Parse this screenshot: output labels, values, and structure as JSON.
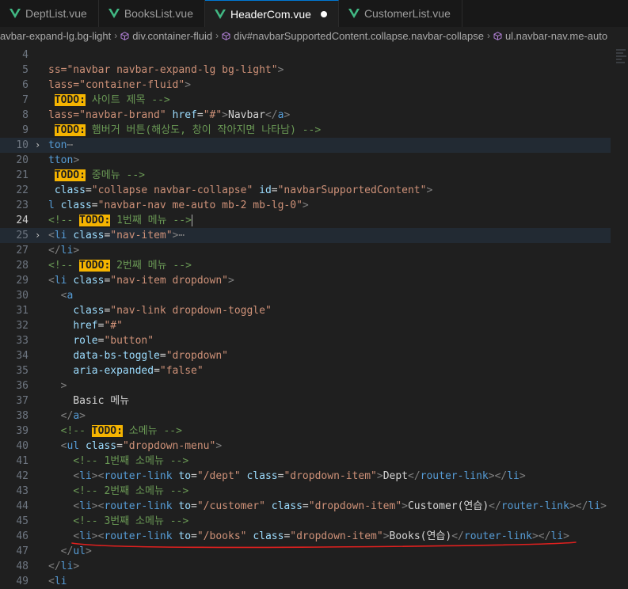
{
  "tabs": [
    {
      "label": "DeptList.vue",
      "active": false
    },
    {
      "label": "BooksList.vue",
      "active": false
    },
    {
      "label": "HeaderCom.vue",
      "active": true,
      "modified": true
    },
    {
      "label": "CustomerList.vue",
      "active": false
    }
  ],
  "breadcrumbs": [
    "avbar-expand-lg.bg-light",
    "div.container-fluid",
    "div#navbarSupportedContent.collapse.navbar-collapse",
    "ul.navbar-nav.me-auto"
  ],
  "colors": {
    "accent": "#0078d4",
    "todo": "#f5b400",
    "annotation": "#e0201f"
  },
  "lines": [
    {
      "num": "4",
      "tokens": []
    },
    {
      "num": "5",
      "tokens": [
        [
          "s",
          "ss=\"navbar navbar-expand-lg bg-light\""
        ],
        [
          "p",
          ">"
        ]
      ]
    },
    {
      "num": "6",
      "tokens": [
        [
          "s",
          "lass=\"container-fluid\""
        ],
        [
          "p",
          ">"
        ]
      ]
    },
    {
      "num": "7",
      "tokens": [
        [
          "w",
          " "
        ],
        [
          "todo",
          "TODO:"
        ],
        [
          "c",
          " 사이트 제목 -->"
        ]
      ]
    },
    {
      "num": "8",
      "tokens": [
        [
          "s",
          "lass=\"navbar-brand\""
        ],
        [
          "w",
          " "
        ],
        [
          "a",
          "href"
        ],
        [
          "w",
          "="
        ],
        [
          "s",
          "\"#\""
        ],
        [
          "p",
          ">"
        ],
        [
          "w",
          "Navbar"
        ],
        [
          "p",
          "</"
        ],
        [
          "t",
          "a"
        ],
        [
          "p",
          ">"
        ]
      ]
    },
    {
      "num": "9",
      "tokens": [
        [
          "w",
          " "
        ],
        [
          "todo",
          "TODO:"
        ],
        [
          "c",
          " 햄버거 버튼(해상도, 창이 작아지면 나타남) -->"
        ]
      ]
    },
    {
      "num": "10",
      "fold": true,
      "highlight": true,
      "tokens": [
        [
          "t",
          "ton"
        ],
        [
          "p",
          "⋯"
        ]
      ]
    },
    {
      "num": "20",
      "tokens": [
        [
          "t",
          "tton"
        ],
        [
          "p",
          ">"
        ]
      ]
    },
    {
      "num": "21",
      "tokens": [
        [
          "w",
          " "
        ],
        [
          "todo",
          "TODO:"
        ],
        [
          "c",
          " 중메뉴 -->"
        ]
      ]
    },
    {
      "num": "22",
      "tokens": [
        [
          "w",
          " "
        ],
        [
          "a",
          "class"
        ],
        [
          "w",
          "="
        ],
        [
          "s",
          "\"collapse navbar-collapse\""
        ],
        [
          "w",
          " "
        ],
        [
          "a",
          "id"
        ],
        [
          "w",
          "="
        ],
        [
          "s",
          "\"navbarSupportedContent\""
        ],
        [
          "p",
          ">"
        ]
      ]
    },
    {
      "num": "23",
      "tokens": [
        [
          "t",
          "l"
        ],
        [
          "w",
          " "
        ],
        [
          "a",
          "class"
        ],
        [
          "w",
          "="
        ],
        [
          "s",
          "\"navbar-nav me-auto mb-2 mb-lg-0\""
        ],
        [
          "p",
          ">"
        ]
      ]
    },
    {
      "num": "24",
      "current": true,
      "tokens": [
        [
          "c",
          "<!-- "
        ],
        [
          "todo",
          "TODO:"
        ],
        [
          "c",
          " 1번째 메뉴 -->"
        ],
        [
          "cursor",
          ""
        ]
      ]
    },
    {
      "num": "25",
      "fold": true,
      "highlight": true,
      "tokens": [
        [
          "p",
          "<"
        ],
        [
          "t",
          "li"
        ],
        [
          "w",
          " "
        ],
        [
          "a",
          "class"
        ],
        [
          "w",
          "="
        ],
        [
          "s",
          "\"nav-item\""
        ],
        [
          "p",
          ">⋯"
        ]
      ]
    },
    {
      "num": "27",
      "tokens": [
        [
          "p",
          "</"
        ],
        [
          "t",
          "li"
        ],
        [
          "p",
          ">"
        ]
      ]
    },
    {
      "num": "28",
      "tokens": [
        [
          "c",
          "<!-- "
        ],
        [
          "todo",
          "TODO:"
        ],
        [
          "c",
          " 2번째 메뉴 -->"
        ]
      ]
    },
    {
      "num": "29",
      "tokens": [
        [
          "p",
          "<"
        ],
        [
          "t",
          "li"
        ],
        [
          "w",
          " "
        ],
        [
          "a",
          "class"
        ],
        [
          "w",
          "="
        ],
        [
          "s",
          "\"nav-item dropdown\""
        ],
        [
          "p",
          ">"
        ]
      ]
    },
    {
      "num": "30",
      "tokens": [
        [
          "w",
          "  "
        ],
        [
          "p",
          "<"
        ],
        [
          "t",
          "a"
        ]
      ]
    },
    {
      "num": "31",
      "tokens": [
        [
          "w",
          "    "
        ],
        [
          "a",
          "class"
        ],
        [
          "w",
          "="
        ],
        [
          "s",
          "\"nav-link dropdown-toggle\""
        ]
      ]
    },
    {
      "num": "32",
      "tokens": [
        [
          "w",
          "    "
        ],
        [
          "a",
          "href"
        ],
        [
          "w",
          "="
        ],
        [
          "s",
          "\"#\""
        ]
      ]
    },
    {
      "num": "33",
      "tokens": [
        [
          "w",
          "    "
        ],
        [
          "a",
          "role"
        ],
        [
          "w",
          "="
        ],
        [
          "s",
          "\"button\""
        ]
      ]
    },
    {
      "num": "34",
      "tokens": [
        [
          "w",
          "    "
        ],
        [
          "a",
          "data-bs-toggle"
        ],
        [
          "w",
          "="
        ],
        [
          "s",
          "\"dropdown\""
        ]
      ]
    },
    {
      "num": "35",
      "tokens": [
        [
          "w",
          "    "
        ],
        [
          "a",
          "aria-expanded"
        ],
        [
          "w",
          "="
        ],
        [
          "s",
          "\"false\""
        ]
      ]
    },
    {
      "num": "36",
      "tokens": [
        [
          "w",
          "  "
        ],
        [
          "p",
          ">"
        ]
      ]
    },
    {
      "num": "37",
      "tokens": [
        [
          "w",
          "    Basic 메뉴"
        ]
      ]
    },
    {
      "num": "38",
      "tokens": [
        [
          "w",
          "  "
        ],
        [
          "p",
          "</"
        ],
        [
          "t",
          "a"
        ],
        [
          "p",
          ">"
        ]
      ]
    },
    {
      "num": "39",
      "tokens": [
        [
          "w",
          "  "
        ],
        [
          "c",
          "<!-- "
        ],
        [
          "todo",
          "TODO:"
        ],
        [
          "c",
          " 소메뉴 -->"
        ]
      ]
    },
    {
      "num": "40",
      "tokens": [
        [
          "w",
          "  "
        ],
        [
          "p",
          "<"
        ],
        [
          "t",
          "ul"
        ],
        [
          "w",
          " "
        ],
        [
          "a",
          "class"
        ],
        [
          "w",
          "="
        ],
        [
          "s",
          "\"dropdown-menu\""
        ],
        [
          "p",
          ">"
        ]
      ]
    },
    {
      "num": "41",
      "tokens": [
        [
          "w",
          "    "
        ],
        [
          "c",
          "<!-- 1번째 소메뉴 -->"
        ]
      ]
    },
    {
      "num": "42",
      "tokens": [
        [
          "w",
          "    "
        ],
        [
          "p",
          "<"
        ],
        [
          "t",
          "li"
        ],
        [
          "p",
          "><"
        ],
        [
          "t",
          "router-link"
        ],
        [
          "w",
          " "
        ],
        [
          "a",
          "to"
        ],
        [
          "w",
          "="
        ],
        [
          "s",
          "\"/dept\""
        ],
        [
          "w",
          " "
        ],
        [
          "a",
          "class"
        ],
        [
          "w",
          "="
        ],
        [
          "s",
          "\"dropdown-item\""
        ],
        [
          "p",
          ">"
        ],
        [
          "w",
          "Dept"
        ],
        [
          "p",
          "</"
        ],
        [
          "t",
          "router-link"
        ],
        [
          "p",
          "></"
        ],
        [
          "t",
          "li"
        ],
        [
          "p",
          ">"
        ]
      ]
    },
    {
      "num": "43",
      "tokens": [
        [
          "w",
          "    "
        ],
        [
          "c",
          "<!-- 2번째 소메뉴 -->"
        ]
      ]
    },
    {
      "num": "44",
      "tokens": [
        [
          "w",
          "    "
        ],
        [
          "p",
          "<"
        ],
        [
          "t",
          "li"
        ],
        [
          "p",
          "><"
        ],
        [
          "t",
          "router-link"
        ],
        [
          "w",
          " "
        ],
        [
          "a",
          "to"
        ],
        [
          "w",
          "="
        ],
        [
          "s",
          "\"/customer\""
        ],
        [
          "w",
          " "
        ],
        [
          "a",
          "class"
        ],
        [
          "w",
          "="
        ],
        [
          "s",
          "\"dropdown-item\""
        ],
        [
          "p",
          ">"
        ],
        [
          "w",
          "Customer(연습)"
        ],
        [
          "p",
          "</"
        ],
        [
          "t",
          "router-link"
        ],
        [
          "p",
          "></"
        ],
        [
          "t",
          "li"
        ],
        [
          "p",
          ">"
        ]
      ]
    },
    {
      "num": "45",
      "tokens": [
        [
          "w",
          "    "
        ],
        [
          "c",
          "<!-- 3번째 소메뉴 -->"
        ]
      ]
    },
    {
      "num": "46",
      "annotated": true,
      "tokens": [
        [
          "w",
          "    "
        ],
        [
          "p",
          "<"
        ],
        [
          "t",
          "li"
        ],
        [
          "p",
          "><"
        ],
        [
          "t",
          "router-link"
        ],
        [
          "w",
          " "
        ],
        [
          "a",
          "to"
        ],
        [
          "w",
          "="
        ],
        [
          "s",
          "\"/books\""
        ],
        [
          "w",
          " "
        ],
        [
          "a",
          "class"
        ],
        [
          "w",
          "="
        ],
        [
          "s",
          "\"dropdown-item\""
        ],
        [
          "p",
          ">"
        ],
        [
          "w",
          "Books(연습)"
        ],
        [
          "p",
          "</"
        ],
        [
          "t",
          "router-link"
        ],
        [
          "p",
          "></"
        ],
        [
          "t",
          "li"
        ],
        [
          "p",
          ">"
        ]
      ]
    },
    {
      "num": "47",
      "tokens": [
        [
          "w",
          "  "
        ],
        [
          "p",
          "</"
        ],
        [
          "t",
          "ul"
        ],
        [
          "p",
          ">"
        ]
      ]
    },
    {
      "num": "48",
      "tokens": [
        [
          "p",
          "</"
        ],
        [
          "t",
          "li"
        ],
        [
          "p",
          ">"
        ]
      ]
    },
    {
      "num": "49",
      "tokens": [
        [
          "p",
          "<"
        ],
        [
          "t",
          "li"
        ]
      ]
    }
  ]
}
